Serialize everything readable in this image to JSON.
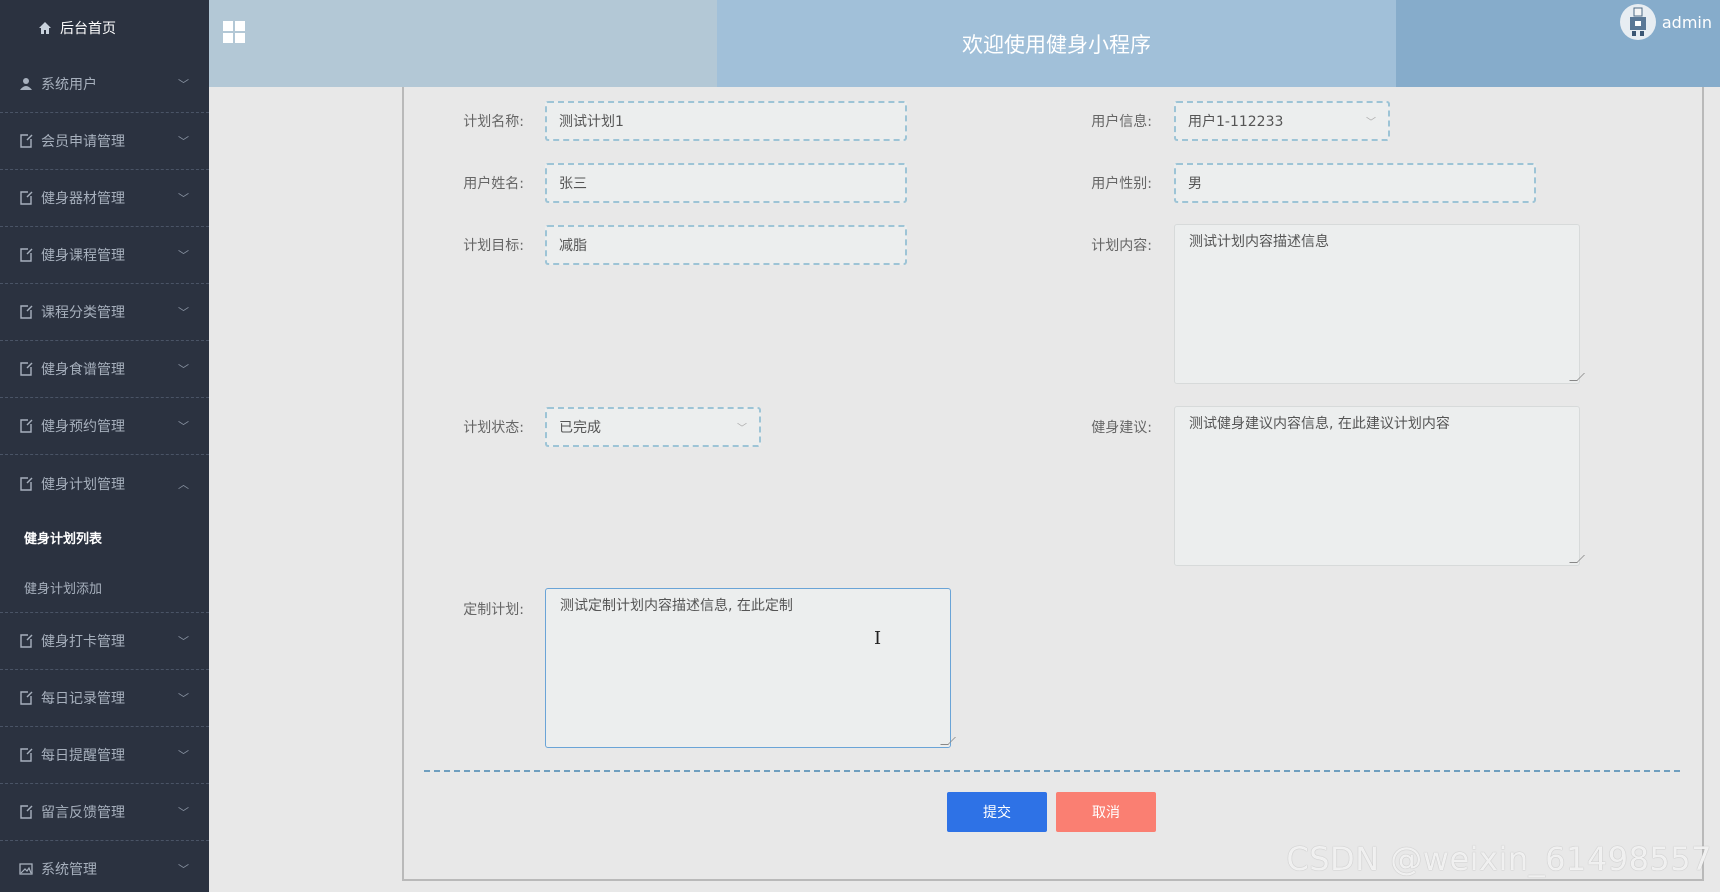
{
  "sidebar": {
    "home_label": "后台首页",
    "items": [
      {
        "label": "系统用户",
        "icon": "user-icon"
      },
      {
        "label": "会员申请管理",
        "icon": "document-icon"
      },
      {
        "label": "健身器材管理",
        "icon": "document-icon"
      },
      {
        "label": "健身课程管理",
        "icon": "document-icon"
      },
      {
        "label": "课程分类管理",
        "icon": "document-icon"
      },
      {
        "label": "健身食谱管理",
        "icon": "document-icon"
      },
      {
        "label": "健身预约管理",
        "icon": "document-icon"
      },
      {
        "label": "健身计划管理",
        "icon": "document-icon"
      },
      {
        "label": "健身打卡管理",
        "icon": "document-icon"
      },
      {
        "label": "每日记录管理",
        "icon": "document-icon"
      },
      {
        "label": "每日提醒管理",
        "icon": "document-icon"
      },
      {
        "label": "留言反馈管理",
        "icon": "document-icon"
      },
      {
        "label": "系统管理",
        "icon": "image-icon"
      }
    ],
    "sub_items": [
      {
        "label": "健身计划列表",
        "active": true
      },
      {
        "label": "健身计划添加",
        "active": false
      }
    ]
  },
  "header": {
    "title": "欢迎使用健身小程序",
    "username": "admin"
  },
  "form": {
    "plan_name": {
      "label": "计划名称:",
      "value": "测试计划1"
    },
    "user_info": {
      "label": "用户信息:",
      "value": "用户1-112233"
    },
    "user_name": {
      "label": "用户姓名:",
      "value": "张三"
    },
    "user_gender": {
      "label": "用户性别:",
      "value": "男"
    },
    "plan_goal": {
      "label": "计划目标:",
      "value": "减脂"
    },
    "plan_content": {
      "label": "计划内容:",
      "value": "测试计划内容描述信息"
    },
    "plan_status": {
      "label": "计划状态:",
      "value": "已完成"
    },
    "fitness_advice": {
      "label": "健身建议:",
      "value": "测试健身建议内容信息, 在此建议计划内容"
    },
    "custom_plan": {
      "label": "定制计划:",
      "value": "测试定制计划内容描述信息, 在此定制"
    }
  },
  "buttons": {
    "submit": "提交",
    "cancel": "取消"
  },
  "colors": {
    "sidebar_bg": "#2b3240",
    "submit": "#2e72e6",
    "cancel": "#fa7f72"
  },
  "watermark": "CSDN @weixin_61498557"
}
